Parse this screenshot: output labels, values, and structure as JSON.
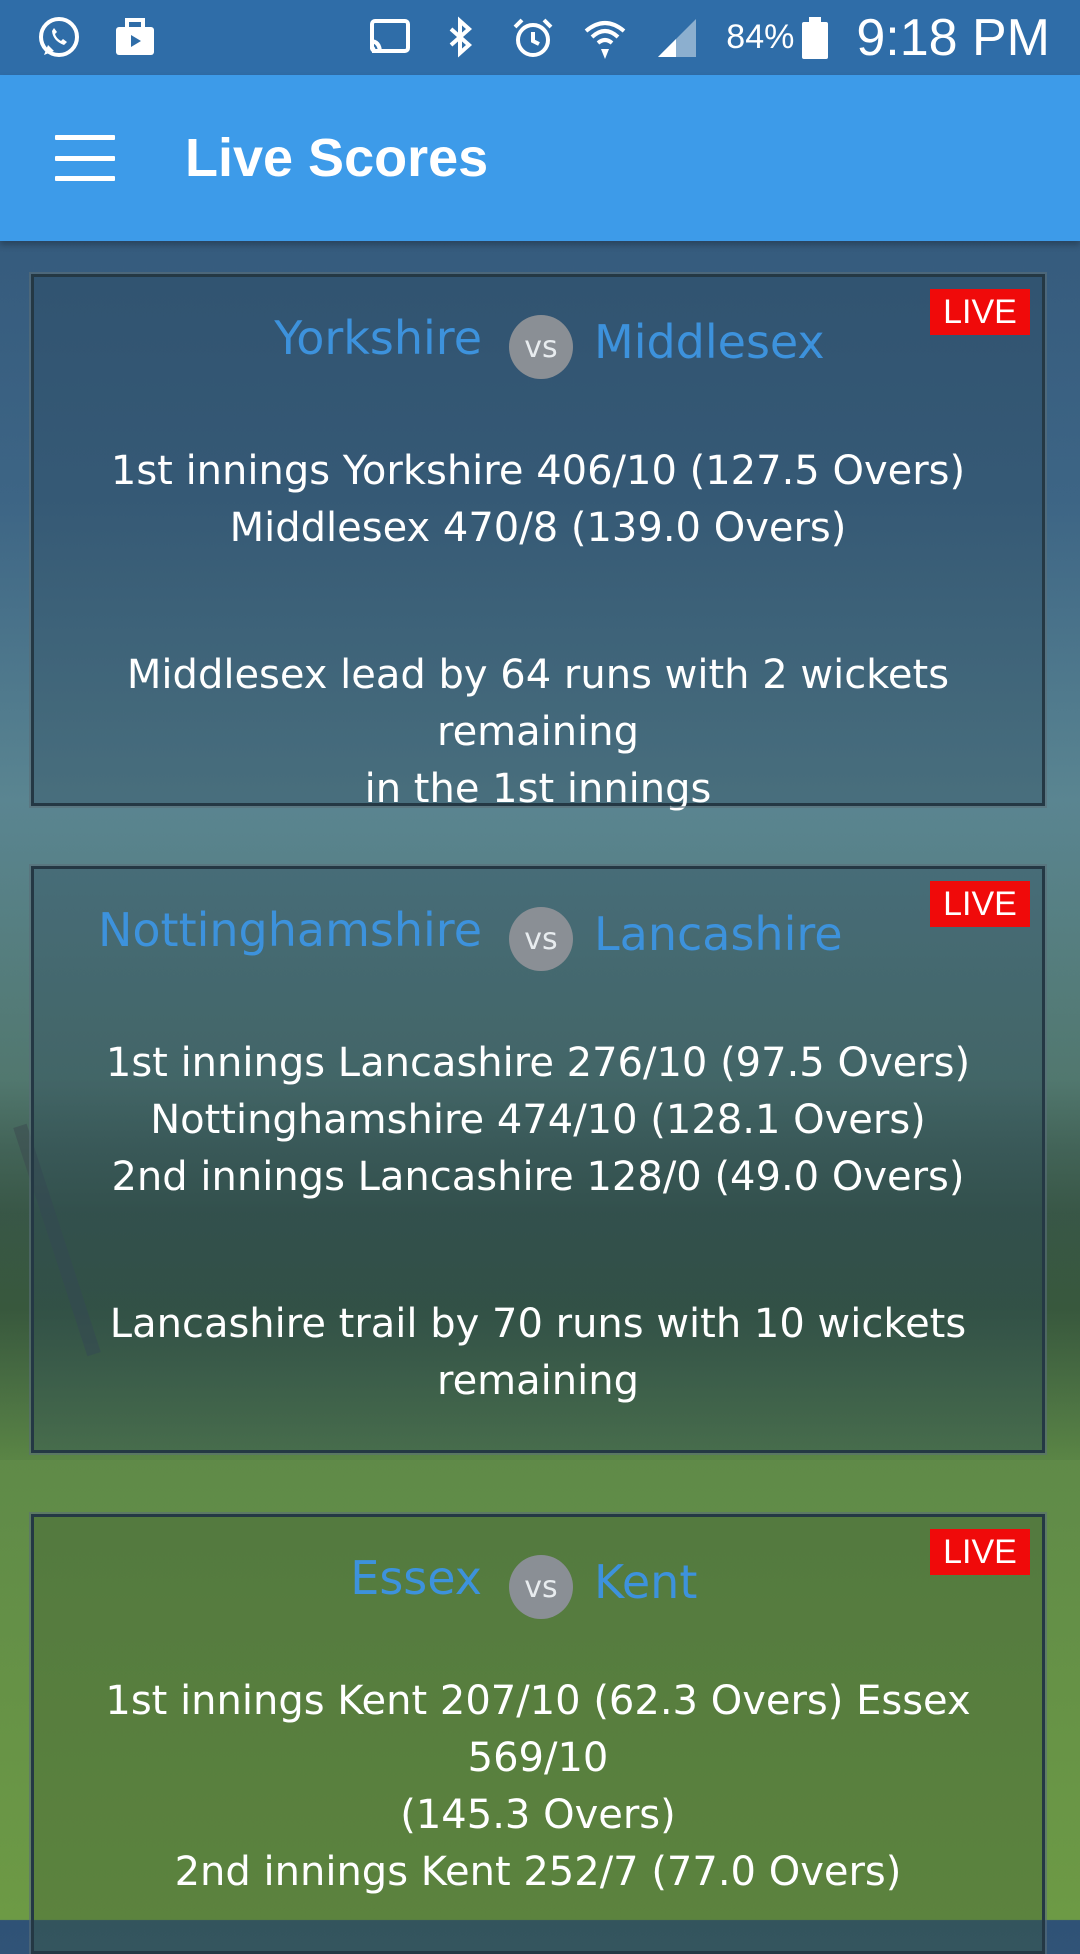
{
  "status_bar": {
    "left_icons": [
      "whatsapp-icon",
      "briefcase-icon"
    ],
    "right_icons": [
      "cast-icon",
      "bluetooth-icon",
      "alarm-icon",
      "wifi-icon",
      "signal-icon"
    ],
    "battery_percent": "84%",
    "time": "9:18 PM"
  },
  "app_bar": {
    "title": "Live Scores",
    "background": "#3d9be9"
  },
  "matches": [
    {
      "live_label": "LIVE",
      "team_a": "Yorkshire",
      "vs": "vs",
      "team_b": "Middlesex",
      "score_lines": [
        "1st innings Yorkshire 406/10 (127.5 Overs)",
        "Middlesex 470/8 (139.0 Overs)"
      ],
      "summary_lines": [
        "Middlesex lead by 64 runs with 2 wickets remaining",
        "in the 1st innings"
      ]
    },
    {
      "live_label": "LIVE",
      "team_a": "Nottinghamshire",
      "vs": "vs",
      "team_b": "Lancashire",
      "score_lines": [
        "1st innings Lancashire 276/10 (97.5 Overs)",
        "Nottinghamshire 474/10 (128.1 Overs)",
        "2nd innings Lancashire 128/0 (49.0 Overs)"
      ],
      "summary_lines": [
        "Lancashire trail by 70 runs with 10 wickets",
        "remaining"
      ]
    },
    {
      "live_label": "LIVE",
      "team_a": "Essex",
      "vs": "vs",
      "team_b": "Kent",
      "score_lines": [
        "1st innings Kent 207/10 (62.3 Overs)  Essex 569/10",
        "(145.3 Overs)",
        "2nd innings Kent 252/7 (77.0 Overs)"
      ],
      "summary_lines": []
    }
  ],
  "colors": {
    "live_badge": "#f00a0a",
    "team_name": "#3d92dc",
    "vs_circle": "#8a8f95"
  }
}
